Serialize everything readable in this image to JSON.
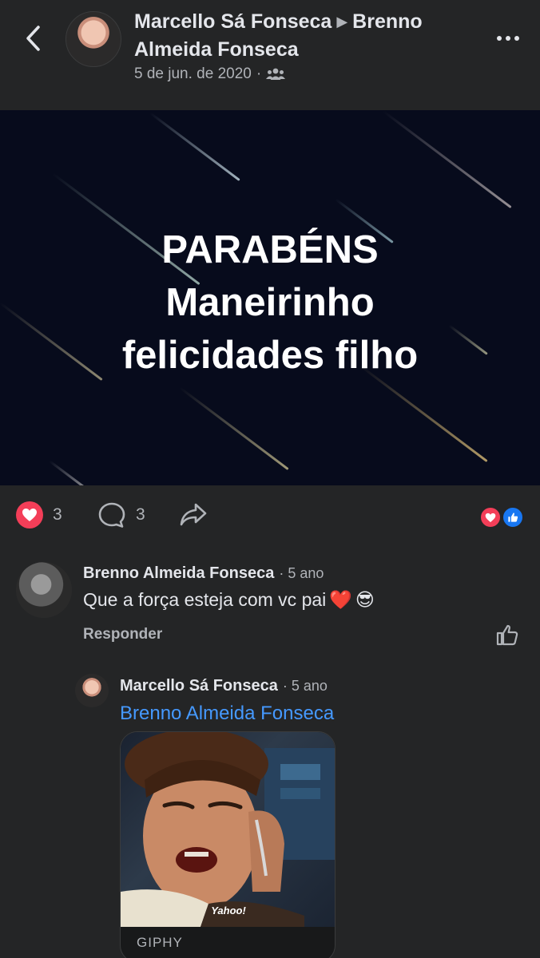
{
  "header": {
    "author": "Marcello Sá Fonseca",
    "target": "Brenno Almeida Fonseca",
    "date": "5 de jun. de 2020",
    "separator": "·"
  },
  "post": {
    "lines": [
      "PARABÉNS",
      "Maneirinho",
      "felicidades filho"
    ]
  },
  "actions": {
    "reaction_count": "3",
    "comment_count": "3"
  },
  "comments": [
    {
      "author": "Brenno Almeida Fonseca",
      "time": "· 5 ano",
      "text": "Que a força esteja com vc pai",
      "emojis": [
        "❤️",
        "😎"
      ],
      "reply_label": "Responder"
    },
    {
      "author": "Marcello Sá Fonseca",
      "time": "· 5 ano",
      "mention": "Brenno Almeida Fonseca",
      "gif_caption": "Yahoo!",
      "gif_source": "GIPHY"
    }
  ],
  "colors": {
    "background": "#242526",
    "love": "#f33e58",
    "like": "#1877f2",
    "link": "#4599ff"
  }
}
